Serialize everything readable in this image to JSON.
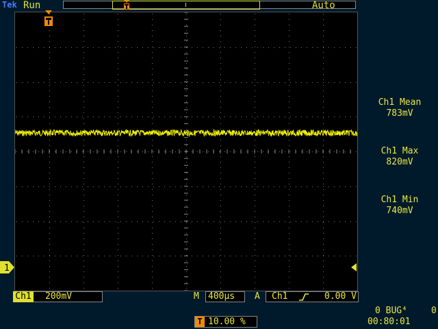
{
  "header": {
    "brand": "Tek",
    "acq_state": "Run",
    "trigger_mode": "Auto"
  },
  "markers": {
    "trigger_marker_label": "T",
    "channel_marker_label": "1"
  },
  "measurements": [
    {
      "label": "Ch1 Mean",
      "value": "783mV"
    },
    {
      "label": "Ch1 Max",
      "value": "820mV"
    },
    {
      "label": "Ch1 Min",
      "value": "740mV"
    }
  ],
  "footer": {
    "ch1_label": "Ch1",
    "ch1_scale": "200mV",
    "m_label": "M",
    "timebase": "400µs",
    "a_label": "A",
    "trigger_source": "Ch1",
    "trigger_level": "0.00 V",
    "position_icon": "T",
    "position_value": "10.00 %",
    "bug_text": "0 BUG⁴",
    "bug_right": "0",
    "clock": "00:80:01"
  },
  "colors": {
    "trace": "#f0f000",
    "background": "#001a2b",
    "screen": "#000000",
    "trigger_orange": "#f08a00",
    "text_yellow": "#e8e840",
    "brand_blue": "#4a7cff"
  }
}
